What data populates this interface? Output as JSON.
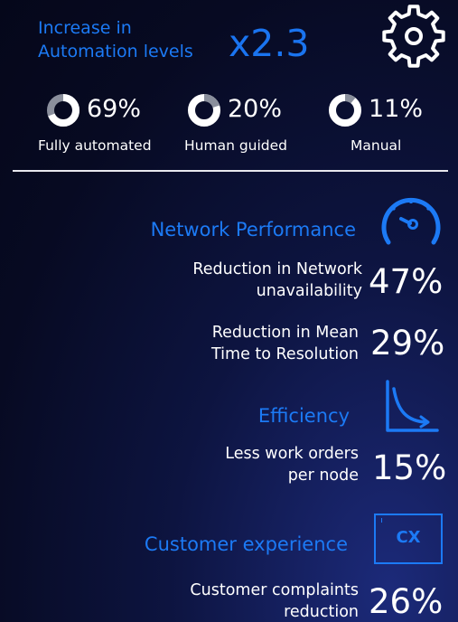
{
  "automation": {
    "title_line1": "Increase in",
    "title_line2": "Automation levels",
    "multiplier": "x2.3",
    "breakdown": [
      {
        "percent": "69%",
        "label": "Fully automated",
        "fraction": 0.69
      },
      {
        "percent": "20%",
        "label": "Human guided",
        "fraction": 0.2
      },
      {
        "percent": "11%",
        "label": "Manual",
        "fraction": 0.11
      }
    ]
  },
  "network_performance": {
    "title": "Network Performance",
    "metrics": [
      {
        "line1": "Reduction in Network",
        "line2": "unavailability",
        "value": "47%"
      },
      {
        "line1": "Reduction in Mean",
        "line2": "Time to Resolution",
        "value": "29%"
      }
    ]
  },
  "efficiency": {
    "title": "Efficiency",
    "metric": {
      "line1": "Less work orders",
      "line2": "per node",
      "value": "15%"
    }
  },
  "customer_experience": {
    "title": "Customer experience",
    "icon_text": "CX",
    "metric": {
      "line1": "Customer complaints",
      "line2": "reduction",
      "value": "26%"
    }
  },
  "colors": {
    "accent": "#1a74f0",
    "background": "#070a22",
    "text": "#ffffff"
  },
  "icons": [
    "gear-icon",
    "speedometer-icon",
    "decline-curve-icon",
    "cx-icon"
  ]
}
